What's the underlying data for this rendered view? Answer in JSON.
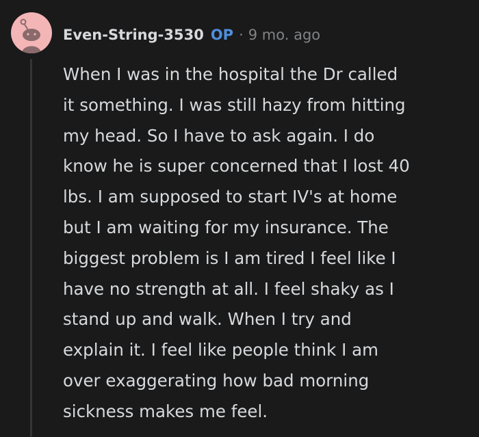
{
  "comment": {
    "avatar_icon": "reddit-snoo-avatar-icon",
    "avatar_color": "#f4b5b6",
    "username": "Even-String-3530",
    "op_badge": "OP",
    "op_color": "#4f8edb",
    "separator": "·",
    "timestamp": "9 mo. ago",
    "lines": [
      "When I was in the hospital the Dr called",
      "it something. I was still hazy from hitting",
      "my head. So I have to ask again. I do",
      "know he is super concerned that I lost 40",
      "lbs. I am supposed to start IV's at home",
      "but I am waiting for my insurance. The",
      "biggest problem is I am tired I feel like I",
      "have no strength at all. I feel shaky as I",
      "stand up and walk. When I try and",
      "explain it. I feel like people think I am",
      "over exaggerating how bad morning",
      "sickness makes me feel."
    ]
  }
}
